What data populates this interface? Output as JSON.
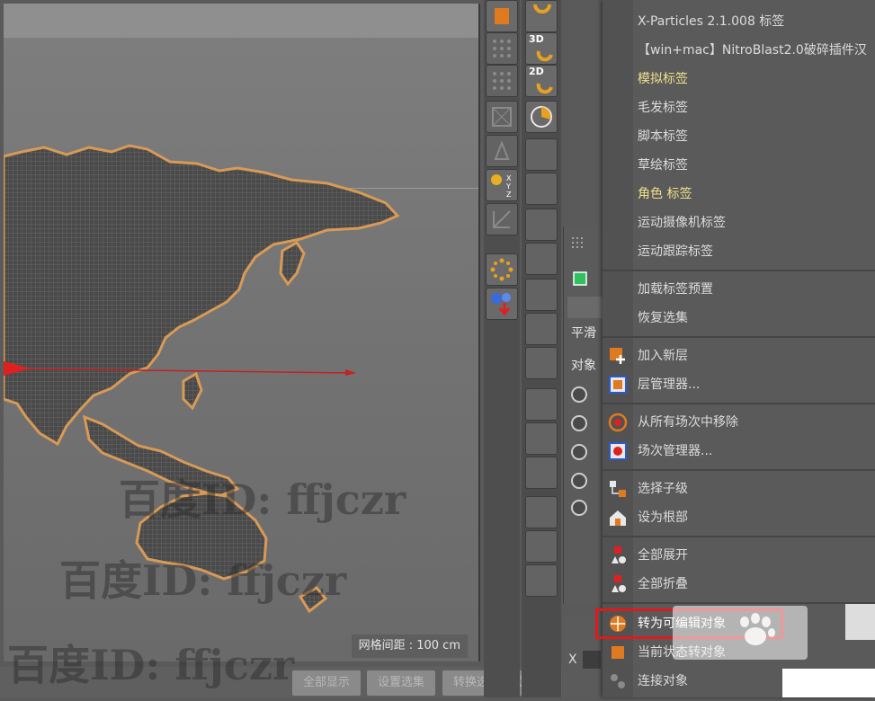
{
  "viewport": {
    "grid_label": "网格间距 : 100 cm"
  },
  "bottombar": {
    "buttons": [
      "全部显示",
      "设置选集",
      "转换选择模式"
    ]
  },
  "toolcol": {
    "labels": [
      "3D",
      "2D"
    ]
  },
  "attr": {
    "smooth_label": "平滑",
    "object_label": "对象"
  },
  "menu": {
    "group1": [
      {
        "label": "X-Particles 2.1.008 标签",
        "color": "normal"
      },
      {
        "label": "【win+mac】NitroBlast2.0破碎插件汉",
        "color": "normal"
      },
      {
        "label": "模拟标签",
        "color": "yellow"
      },
      {
        "label": "毛发标签",
        "color": "normal"
      },
      {
        "label": "脚本标签",
        "color": "normal"
      },
      {
        "label": "草绘标签",
        "color": "normal"
      },
      {
        "label": "角色 标签",
        "color": "yellow"
      },
      {
        "label": "运动摄像机标签",
        "color": "normal"
      },
      {
        "label": "运动跟踪标签",
        "color": "normal"
      }
    ],
    "group2": [
      "加载标签预置",
      "恢复选集"
    ],
    "group3": [
      "加入新层",
      "层管理器..."
    ],
    "group4": [
      "从所有场次中移除",
      "场次管理器..."
    ],
    "group5": [
      "选择子级",
      "设为根部"
    ],
    "group6": [
      "全部展开",
      "全部折叠"
    ],
    "group7": [
      "转为可编辑对象",
      "当前状态转对象",
      "连接对象"
    ]
  },
  "watermark": "百度ID: ffjczr",
  "colors": {
    "highlight": "#e0191b",
    "yellow_text": "#efe08a",
    "map_outline": "#d89a56"
  }
}
